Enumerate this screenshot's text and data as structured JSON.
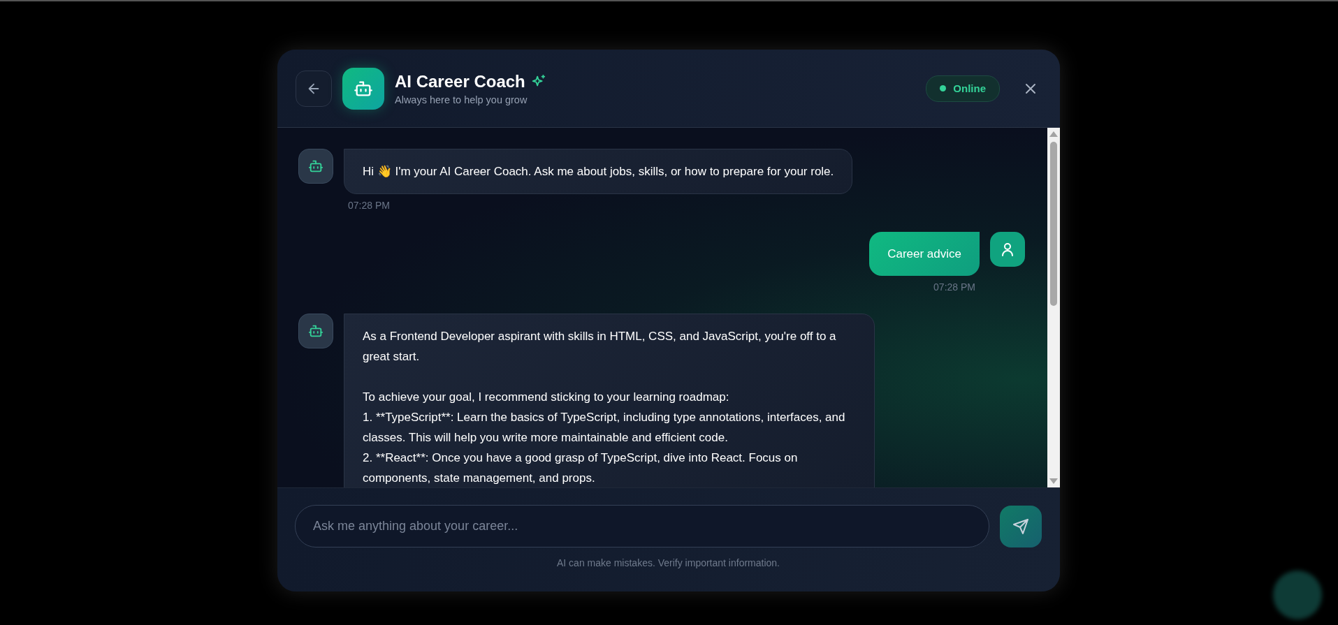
{
  "header": {
    "title": "AI Career Coach",
    "subtitle": "Always here to help you grow",
    "status": {
      "label": "Online",
      "online": true
    }
  },
  "messages": [
    {
      "kind": "bot",
      "text": "Hi 👋 I'm your AI Career Coach. Ask me about jobs, skills, or how to prepare for your role.",
      "time": "07:28 PM"
    },
    {
      "kind": "user",
      "text": "Career advice",
      "time": "07:28 PM"
    },
    {
      "kind": "bot",
      "text": "As a Frontend Developer aspirant with skills in HTML, CSS, and JavaScript, you're off to a great start.\n\nTo achieve your goal, I recommend sticking to your learning roadmap:\n1. **TypeScript**: Learn the basics of TypeScript, including type annotations, interfaces, and classes. This will help you write more maintainable and efficient code.\n2. **React**: Once you have a good grasp of TypeScript, dive into React. Focus on components, state management, and props."
    }
  ],
  "composer": {
    "placeholder": "Ask me anything about your career...",
    "disclaimer": "AI can make mistakes. Verify important information."
  }
}
